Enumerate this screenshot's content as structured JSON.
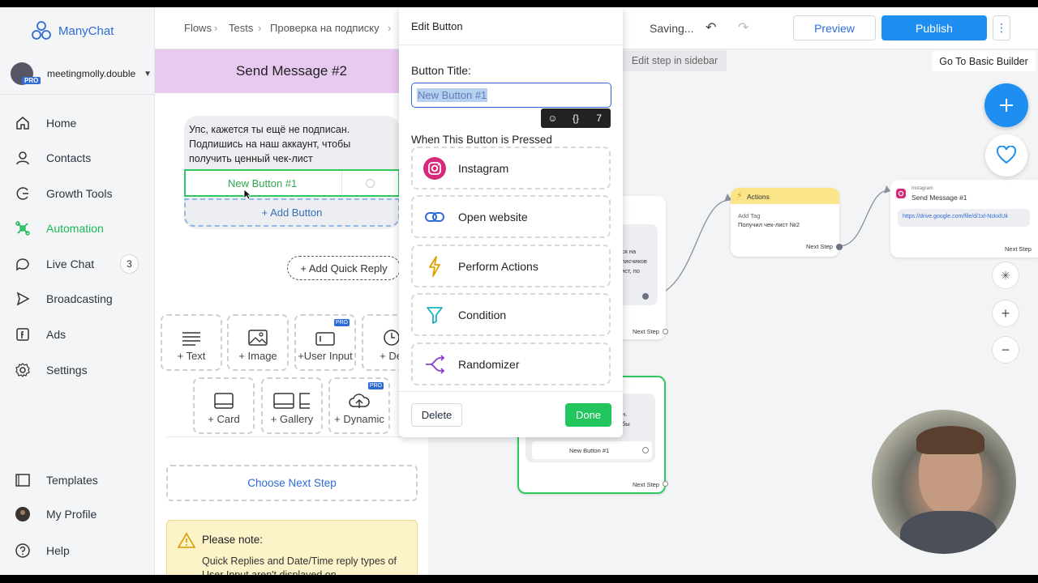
{
  "brand": {
    "name": "ManyChat",
    "accent": "#2f6bd4",
    "green": "#1db954"
  },
  "account": {
    "name": "meetingmolly.double",
    "badge": "PRO"
  },
  "nav": [
    {
      "label": "Home",
      "icon": "home-icon"
    },
    {
      "label": "Contacts",
      "icon": "user-icon"
    },
    {
      "label": "Growth Tools",
      "icon": "growth-icon"
    },
    {
      "label": "Automation",
      "icon": "automation-icon"
    },
    {
      "label": "Live Chat",
      "icon": "chat-icon",
      "count": "3"
    },
    {
      "label": "Broadcasting",
      "icon": "send-icon"
    },
    {
      "label": "Ads",
      "icon": "ads-icon"
    },
    {
      "label": "Settings",
      "icon": "gear-icon"
    }
  ],
  "nav_bottom": [
    {
      "label": "Templates",
      "icon": "templates-icon"
    },
    {
      "label": "My Profile",
      "icon": "profile-icon"
    },
    {
      "label": "Help",
      "icon": "help-icon"
    }
  ],
  "breadcrumb": [
    "Flows",
    "Tests",
    "Проверка на подписку"
  ],
  "header": {
    "saving": "Saving...",
    "preview": "Preview",
    "publish": "Publish",
    "go_basic": "Go To Basic Builder",
    "edit_sidebar": "Edit step in sidebar"
  },
  "message": {
    "title": "Send Message #2",
    "text": "Упс, кажется ты ещё не подписан. Подпишись на наш аккаунт, чтобы получить ценный чек-лист",
    "button": "New Button #1",
    "add_button": "+ Add Button",
    "quick_reply": "+ Add Quick Reply"
  },
  "tiles": [
    {
      "label": "+ Text"
    },
    {
      "label": "+ Image"
    },
    {
      "label": "+User Input",
      "pro": "PRO"
    },
    {
      "label": "+ De"
    },
    {
      "label": "+ Card"
    },
    {
      "label": "+ Gallery"
    },
    {
      "label": "+ Dynamic",
      "pro": "PRO"
    }
  ],
  "choose_next": "Choose Next Step",
  "note": {
    "title": "Please note:",
    "body": "Quick Replies and Date/Time reply types of User Input aren't displayed on"
  },
  "popup": {
    "title": "Edit Button",
    "field_label": "Button Title:",
    "field_value": "New Button #1",
    "counter": "7",
    "when": "When This Button is Pressed",
    "options": [
      "Instagram",
      "Open website",
      "Perform Actions",
      "Condition",
      "Randomizer"
    ],
    "delete": "Delete",
    "done": "Done"
  },
  "canvas": {
    "actions_title": "Actions",
    "actions_sub": "Add Tag",
    "actions_tag": "Получил чек-лист №2",
    "next_step": "Next Step",
    "ig_small": "Instagram",
    "ig_title": "Send Message #1",
    "ig_link": "https://drive.google.com/file/d/1xl-NckxlUk",
    "left_text": "ся на\nлисчиков\nист, по",
    "green_text": "н.\nбы",
    "green_button": "New Button #1"
  }
}
